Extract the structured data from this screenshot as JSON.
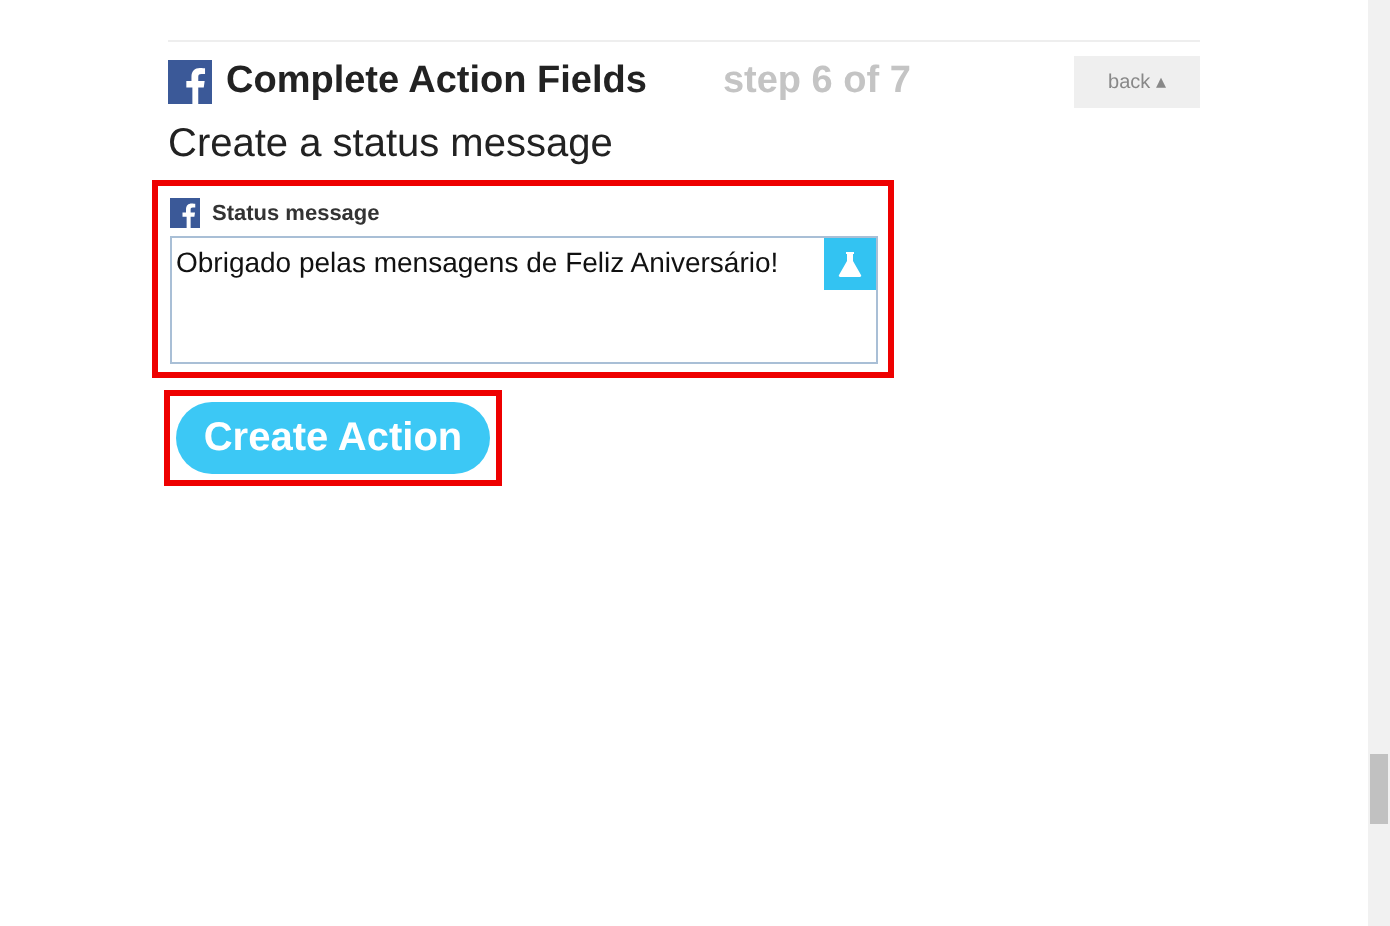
{
  "header": {
    "title": "Complete Action Fields",
    "step": "step 6 of 7",
    "back_button": "back ▴"
  },
  "subtitle": "Create a status message",
  "field": {
    "label": "Status message",
    "value": "Obrigado pelas mensagens de Feliz Aniversário!",
    "highlighted": true
  },
  "submit_button": {
    "label": "Create Action",
    "highlighted": true
  }
}
